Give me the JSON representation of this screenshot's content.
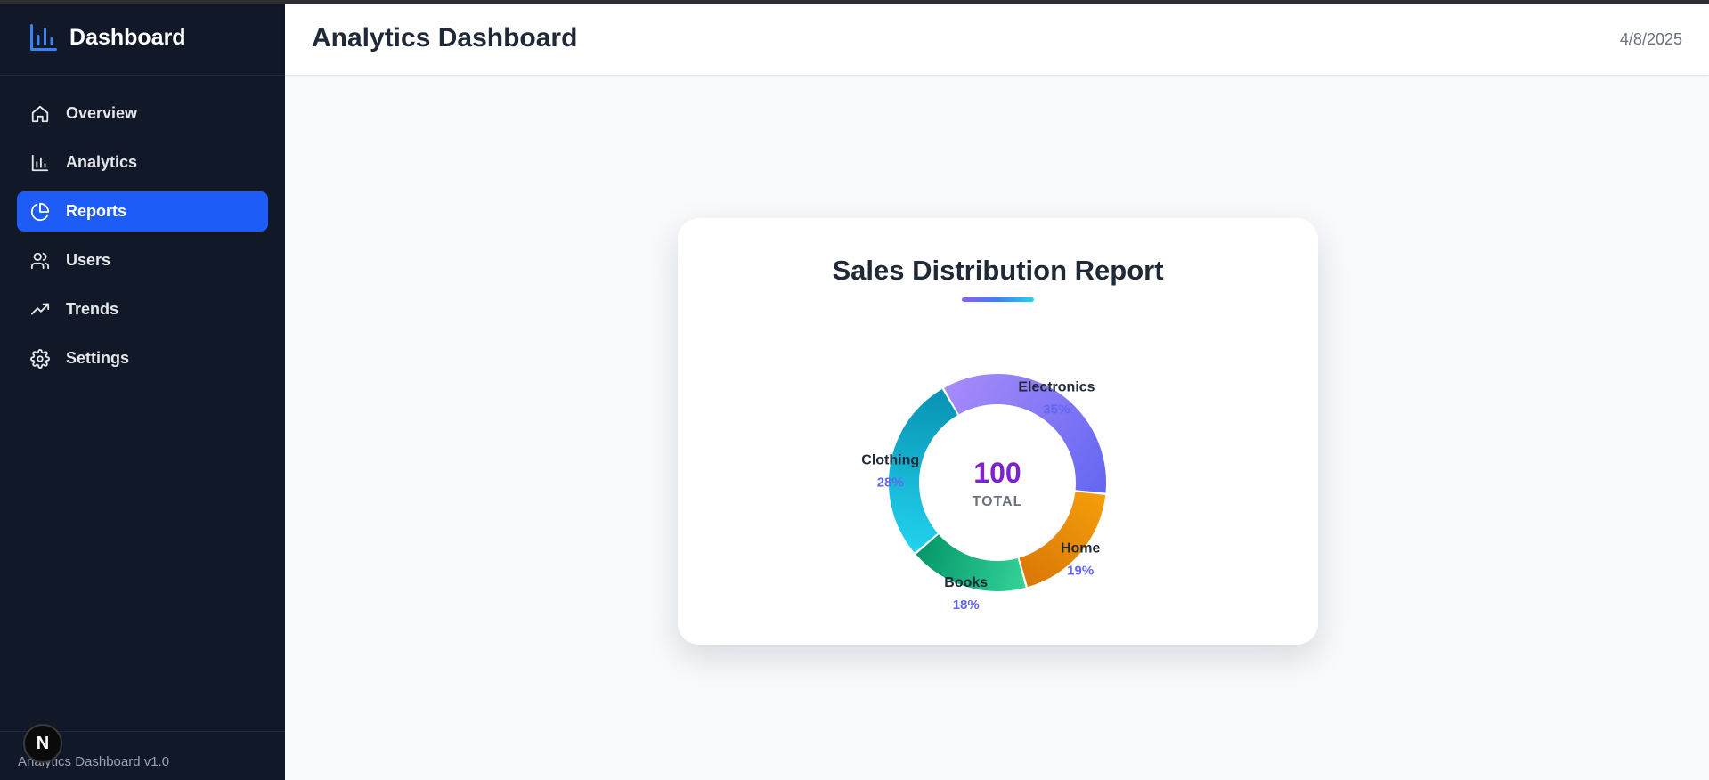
{
  "topbar_color": "#2d2d33",
  "sidebar": {
    "brand": {
      "title": "Dashboard",
      "icon": "bar-chart-icon",
      "icon_color": "#3b82f6"
    },
    "items": [
      {
        "label": "Overview",
        "icon": "home-icon",
        "active": false
      },
      {
        "label": "Analytics",
        "icon": "bar-chart-icon",
        "active": false
      },
      {
        "label": "Reports",
        "icon": "pie-chart-icon",
        "active": true
      },
      {
        "label": "Users",
        "icon": "users-icon",
        "active": false
      },
      {
        "label": "Trends",
        "icon": "trending-up-icon",
        "active": false
      },
      {
        "label": "Settings",
        "icon": "gear-icon",
        "active": false
      }
    ],
    "footer": {
      "text": "Analytics Dashboard v1.0",
      "badge_letter": "N"
    },
    "background": "#111827",
    "active_color": "#1d5cf6"
  },
  "header": {
    "title": "Analytics Dashboard",
    "date": "4/8/2025"
  },
  "card": {
    "title": "Sales Distribution Report"
  },
  "chart_data": {
    "type": "pie",
    "variant": "donut",
    "title": "Sales Distribution Report",
    "center_value": "100",
    "center_label": "TOTAL",
    "slices": [
      {
        "label": "Electronics",
        "value": 35,
        "pct_label": "35%",
        "color_start": "#a78bfa",
        "color_end": "#6366f1"
      },
      {
        "label": "Home",
        "value": 19,
        "pct_label": "19%",
        "color_start": "#f59e0b",
        "color_end": "#d97706"
      },
      {
        "label": "Books",
        "value": 18,
        "pct_label": "18%",
        "color_start": "#34d399",
        "color_end": "#059669"
      },
      {
        "label": "Clothing",
        "value": 28,
        "pct_label": "28%",
        "color_start": "#22d3ee",
        "color_end": "#0891b2"
      }
    ],
    "start_angle_deg": -120,
    "direction": "clockwise"
  }
}
